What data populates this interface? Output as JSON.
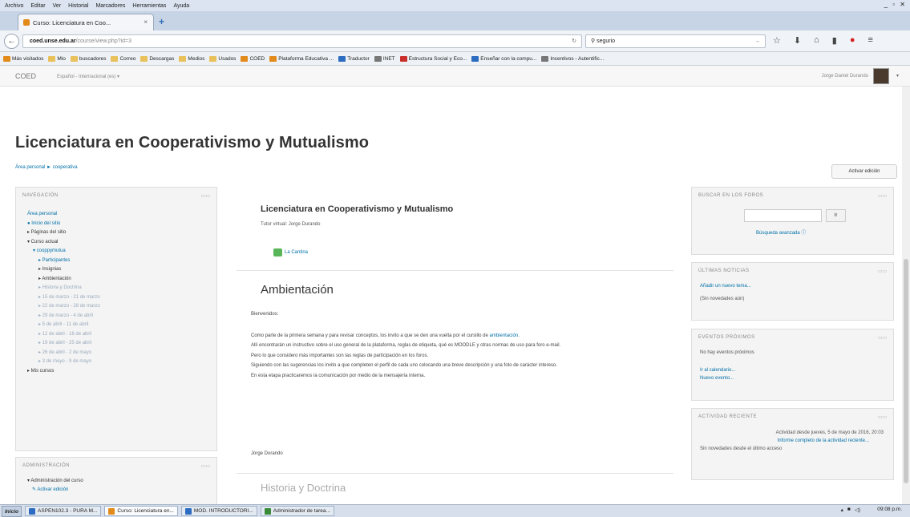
{
  "browser": {
    "menubar": [
      "Archivo",
      "Editar",
      "Ver",
      "Historial",
      "Marcadores",
      "Herramientas",
      "Ayuda"
    ],
    "window_controls": "_ ▫ ✕",
    "tab_title": "Curso: Licenciatura en Coo...",
    "url_domain": "coed.unse.edu.ar",
    "url_path": "/course/view.php?id=3",
    "search_value": "segurio",
    "bookmarks": [
      {
        "label": "Más visitados",
        "color": "#e28a1a"
      },
      {
        "label": "Mio",
        "color": "#e8c15a"
      },
      {
        "label": "buscadores",
        "color": "#e8c15a"
      },
      {
        "label": "Correo",
        "color": "#e8c15a"
      },
      {
        "label": "Descargas",
        "color": "#e8c15a"
      },
      {
        "label": "Medios",
        "color": "#e8c15a"
      },
      {
        "label": "Usados",
        "color": "#e8c15a"
      },
      {
        "label": "COED",
        "color": "#e28a1a"
      },
      {
        "label": "Plataforma Educativa ...",
        "color": "#e28a1a"
      },
      {
        "label": "Traductor",
        "color": "#2d6cc0"
      },
      {
        "label": "INET",
        "color": "#777777"
      },
      {
        "label": "Estructura Social y Eco...",
        "color": "#c9302c"
      },
      {
        "label": "Enseñar con la compu...",
        "color": "#2d6cc0"
      },
      {
        "label": "Incentivos - Autentific...",
        "color": "#777777"
      }
    ]
  },
  "moodle": {
    "brand": "COED",
    "language": "Español - Internacional (es) ▾",
    "user_name": "Jorge Daniel Durando",
    "page_title": "Licenciatura en Cooperativismo y Mutualismo",
    "breadcrumb": "Área personal ► cooperativa",
    "edit_button": "Activar edición"
  },
  "navigation": {
    "title": "NAVEGACIÓN",
    "items": [
      {
        "text": "Área personal",
        "style": "link",
        "indent": 0
      },
      {
        "text": "● Inicio del sitio",
        "style": "link",
        "indent": 0
      },
      {
        "text": "▸ Páginas del sitio",
        "style": "plain",
        "indent": 0
      },
      {
        "text": "▾ Curso actual",
        "style": "plain",
        "indent": 0
      },
      {
        "text": "▾ cooppymutua",
        "style": "link",
        "indent": 1
      },
      {
        "text": "▸ Participantes",
        "style": "link",
        "indent": 2
      },
      {
        "text": "▸ Insignias",
        "style": "plain",
        "indent": 2
      },
      {
        "text": "▸ Ambientación",
        "style": "plain",
        "indent": 2
      },
      {
        "text": "▸ Historia y Doctrina",
        "style": "dim",
        "indent": 2
      },
      {
        "text": "▸ 15 de marzo - 21 de marzo",
        "style": "dim",
        "indent": 2
      },
      {
        "text": "▸ 22 de marzo - 28 de marzo",
        "style": "dim",
        "indent": 2
      },
      {
        "text": "▸ 29 de marzo - 4 de abril",
        "style": "dim",
        "indent": 2
      },
      {
        "text": "▸ 5 de abril - 11 de abril",
        "style": "dim",
        "indent": 2
      },
      {
        "text": "▸ 12 de abril - 18 de abril",
        "style": "dim",
        "indent": 2
      },
      {
        "text": "▸ 19 de abril - 25 de abril",
        "style": "dim",
        "indent": 2
      },
      {
        "text": "▸ 26 de abril - 2 de mayo",
        "style": "dim",
        "indent": 2
      },
      {
        "text": "▸ 3 de mayo - 9 de mayo",
        "style": "dim",
        "indent": 2
      },
      {
        "text": "▸ Mis cursos",
        "style": "plain",
        "indent": 0
      }
    ]
  },
  "administration": {
    "title": "ADMINISTRACIÓN",
    "items": [
      {
        "text": "▾ Administración del curso",
        "style": "plain"
      },
      {
        "text": "✎ Activar edición",
        "style": "link"
      }
    ]
  },
  "course": {
    "title": "Licenciatura en Cooperativismo y Mutualismo",
    "tutor": "Tutor virtual: Jorge Durando",
    "forum_link": "La Cantina",
    "section_title": "Ambientación",
    "greeting": "Bienvenidos:",
    "p1_pre": "Como parte de la primera semana y para revisar conceptos, los invito a que se den una vuelta por el cursillo de ",
    "p1_link": "ambientación",
    "p1_post": ".",
    "p2": "Allí encontrarán un instructivo sobre el uso general de la plataforma, reglas de etiqueta, qué es MOODLE y otras normas de uso para foro e-mail.",
    "p3": "Pero lo que considero más importantes son las reglas de participación en los foros.",
    "p4": "Siguiendo con las sugerencias los invito a que completen el perfil de cada uno colocando una breve descripción y una foto de carácter intereso.",
    "p5": "En esta etapa practicaremos la comunicación por medio de la mensajería interna.",
    "signature": "Jorge Durando",
    "next_section": "Historia y Doctrina"
  },
  "search_forums": {
    "title": "BUSCAR EN LOS FOROS",
    "button": "Ir",
    "advanced": "Búsqueda avanzada"
  },
  "news": {
    "title": "ÚLTIMAS NOTICIAS",
    "add": "Añadir un nuevo tema...",
    "none": "(Sin novedades aún)"
  },
  "events": {
    "title": "EVENTOS PRÓXIMOS",
    "none": "No hay eventos próximos",
    "calendar": "Ir al calendario...",
    "new": "Nuevo evento..."
  },
  "activity": {
    "title": "ACTIVIDAD RECIENTE",
    "since": "Actividad desde jueves, 5 de mayo de 2016, 20:03",
    "report": "Informe completo de la actividad reciente...",
    "none": "Sin novedades desde el último acceso"
  },
  "taskbar": {
    "start": "Inicio",
    "items": [
      {
        "label": "ASPEN102.3 - PURA M...",
        "color": "#2d6cc0",
        "active": false
      },
      {
        "label": "Curso: Licenciatura en...",
        "color": "#e28a1a",
        "active": true
      },
      {
        "label": "MOD. INTRODUCTORI...",
        "color": "#2d6cc0",
        "active": false
      },
      {
        "label": "Administrador de tarea...",
        "color": "#3a8a3a",
        "active": false
      }
    ],
    "clock": "09:08 p.m."
  }
}
